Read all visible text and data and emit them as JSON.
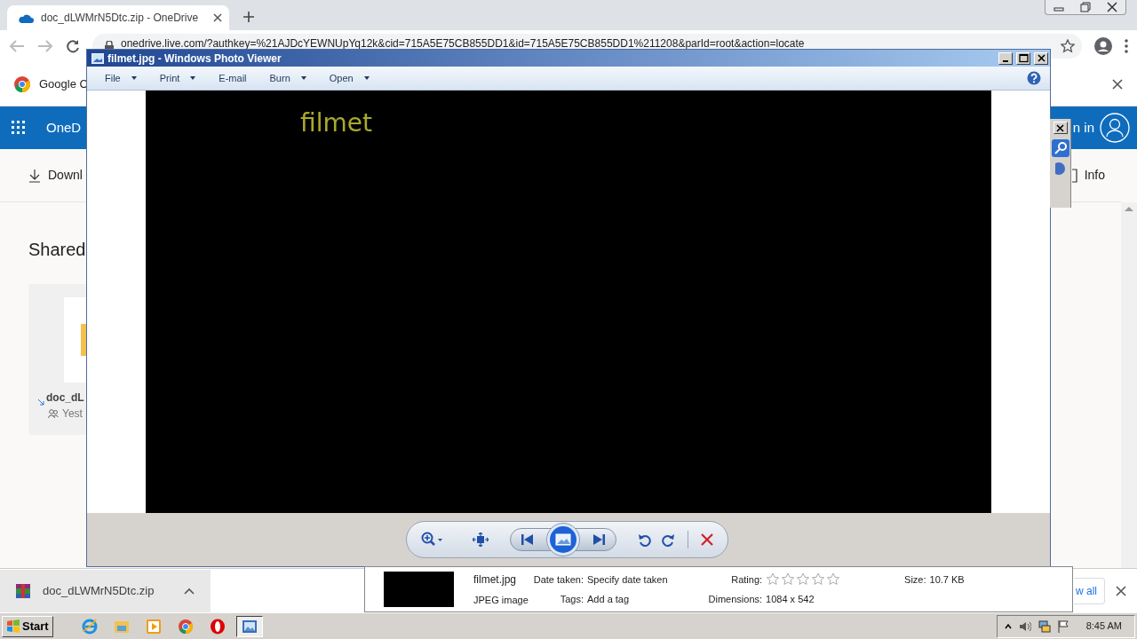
{
  "browser": {
    "tab": {
      "title": "doc_dLWMrN5Dtc.zip - OneDrive",
      "selected": true
    },
    "url": "onedrive.live.com/?authkey=%21AJDcYEWNUpYq12k&cid=715A5E75CB855DD1&id=715A5E75CB855DD1%211208&parId=root&action=locate",
    "infobar": "Google C"
  },
  "onedrive": {
    "app_name": "OneD",
    "sign_in": "n in",
    "commands": [
      {
        "label": "Downl",
        "kind": "download"
      },
      {
        "label": "Info",
        "kind": "info"
      }
    ],
    "heading": "Shared",
    "file": {
      "name": "doc_dL",
      "meta": "Yest"
    }
  },
  "photo_viewer": {
    "title": "filmet.jpg - Windows Photo Viewer",
    "menus": [
      {
        "label": "File",
        "dropdown": true
      },
      {
        "label": "Print",
        "dropdown": true
      },
      {
        "label": "E-mail",
        "dropdown": false
      },
      {
        "label": "Burn",
        "dropdown": true
      },
      {
        "label": "Open",
        "dropdown": true
      }
    ],
    "image_text": "filmet"
  },
  "details": {
    "name": "filmet.jpg",
    "type": "JPEG image",
    "date_taken": {
      "label": "Date taken:",
      "value": "Specify date taken"
    },
    "tags": {
      "label": "Tags:",
      "value": "Add a tag"
    },
    "rating": {
      "label": "Rating:",
      "stars": 0
    },
    "dimensions": {
      "label": "Dimensions:",
      "value": "1084 x 542"
    },
    "size": {
      "label": "Size:",
      "value": "10.7 KB"
    }
  },
  "download_bar": {
    "file_name": "doc_dLWMrN5Dtc.zip",
    "show_all": "w all"
  },
  "taskbar": {
    "start": "Start",
    "apps": [
      {
        "kind": "ie",
        "active": false
      },
      {
        "kind": "explorer",
        "active": false
      },
      {
        "kind": "media",
        "active": false
      },
      {
        "kind": "chrome",
        "active": false
      },
      {
        "kind": "opera",
        "active": false
      },
      {
        "kind": "photo",
        "active": true
      }
    ],
    "clock": "8:45 AM"
  }
}
